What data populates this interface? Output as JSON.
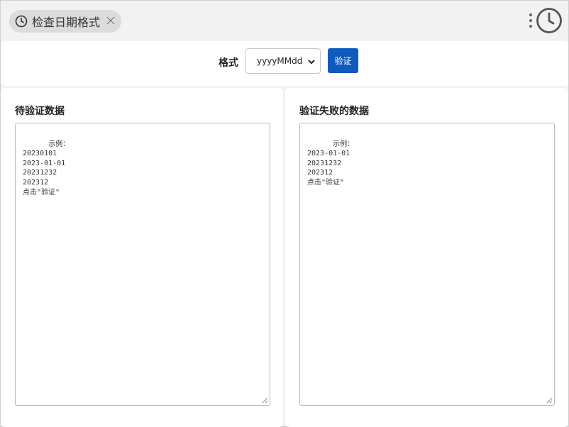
{
  "tab": {
    "title": "检查日期格式"
  },
  "toolbar": {
    "format_label": "格式",
    "format_value": "yyyyMMdd",
    "verify_label": "验证"
  },
  "left_panel": {
    "title": "待验证数据",
    "content": "示例：\n20230101\n2023-01-01\n20231232\n202312\n点击\"验证\""
  },
  "right_panel": {
    "title": "验证失败的数据",
    "content": "示例：\n2023-01-01\n20231232\n202312\n点击\"验证\""
  },
  "colors": {
    "accent": "#0d5bbf",
    "background": "#f2f2f2",
    "pill": "#dcdcdc"
  },
  "icons": [
    "clock-icon",
    "close-icon",
    "more-vertical-icon",
    "chevron-down-icon",
    "resize-handle-icon"
  ]
}
